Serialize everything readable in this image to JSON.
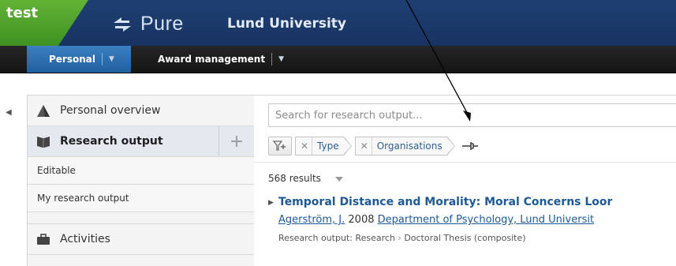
{
  "header": {
    "env_label": "test",
    "logo_text": "Pure",
    "org_name": "Lund University"
  },
  "menubar": {
    "personal_label": "Personal",
    "award_label": "Award management"
  },
  "sidebar": {
    "overview_label": "Personal overview",
    "research_output_label": "Research output",
    "sub_items": [
      "Editable",
      "My research output"
    ],
    "activities_label": "Activities"
  },
  "main": {
    "search_placeholder": "Search for research output...",
    "filters": [
      "Type",
      "Organisations"
    ],
    "results_count": "568 results",
    "result": {
      "title": "Temporal Distance and Morality: Moral Concerns Loor",
      "author": "Agerström, J.",
      "year": "2008",
      "organisation": "Department of Psychology, Lund Universit",
      "type_prefix": "Research output: Research",
      "type_suffix": "Doctoral Thesis (composite)"
    }
  },
  "colors": {
    "header_blue": "#1f3f73",
    "env_green": "#4ea02b",
    "menu_active": "#2d6fb1",
    "link_blue": "#1d5a98"
  }
}
